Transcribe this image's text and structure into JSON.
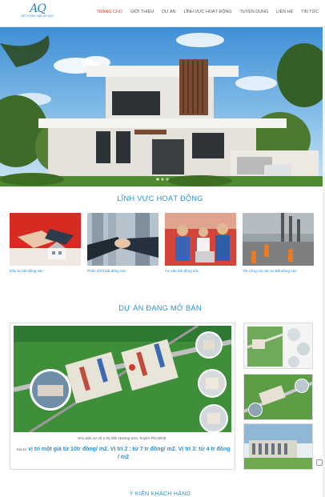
{
  "logo": {
    "mark": "AQ",
    "sub": "BẤT ĐỘNG SẢN AN QUÝ"
  },
  "nav": [
    "TRANG CHỦ",
    "GIỚI THIỆU",
    "DỰ ÁN",
    "LĨNH VỰC HOẠT ĐỘNG",
    "TUYỂN DỤNG",
    "LIÊN HỆ",
    "TIN TỨC"
  ],
  "sections": {
    "fields_title": "LĨNH VỰC HOẠT ĐỘNG",
    "projects_title": "DỰ ÁN ĐANG MỞ BÁN",
    "next_title": "Ý KIẾN KHÁCH HÀNG"
  },
  "fields": [
    {
      "label": "Đầu tư bất động sản"
    },
    {
      "label": "Phân phối bất động sản"
    },
    {
      "label": "Tư vấn bất động sản"
    },
    {
      "label": "Thi công các dự án Bất động sản"
    }
  ],
  "project": {
    "caption_line1": "Khu dân cư số 2 thị trấn Hương Sơn, huyện Phú Bình.",
    "price_key": "Giá từ",
    "price_val": "vị trí một giá từ 10tr đồng/ m2. Vị trí 2 : từ 7 tr đồng/ m2. Vị trí 3: từ 4 tr đồng / m2"
  },
  "colors": {
    "accent": "#2d8fd1",
    "nav_active": "#e03a2f"
  }
}
